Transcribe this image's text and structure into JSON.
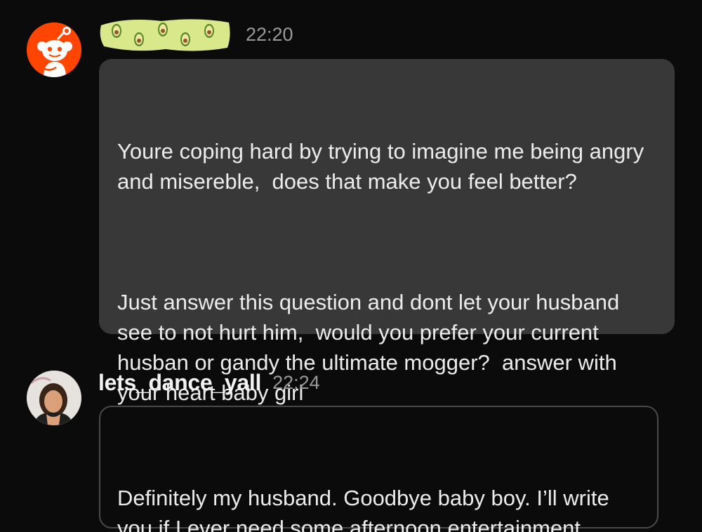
{
  "messages": [
    {
      "username": "",
      "username_redacted": true,
      "time": "22:20",
      "avatar_icon": "reddit-snoo-icon",
      "paragraphs": [
        "Youre coping hard by trying to imagine me being angry and misereble,  does that make you feel better?",
        "Just answer this question and dont let your husband see to not hurt him,  would you prefer your current husban or gandy the ultimate mogger?  answer with your heart baby girl"
      ]
    },
    {
      "username": "lets_dance_yall",
      "time": "22:24",
      "avatar_icon": "profile-photo-icon",
      "paragraphs": [
        "Definitely my husband. Goodbye baby boy. I’ll write you if I ever need some afternoon entertainment"
      ]
    }
  ],
  "colors": {
    "background": "#0b0b0b",
    "bubble": "#383838",
    "bubble_border": "#4a4a4a",
    "text": "#ececec",
    "timestamp": "#9a9a9a",
    "reddit_orange": "#ff4500",
    "redaction_green": "#d9e88a"
  }
}
